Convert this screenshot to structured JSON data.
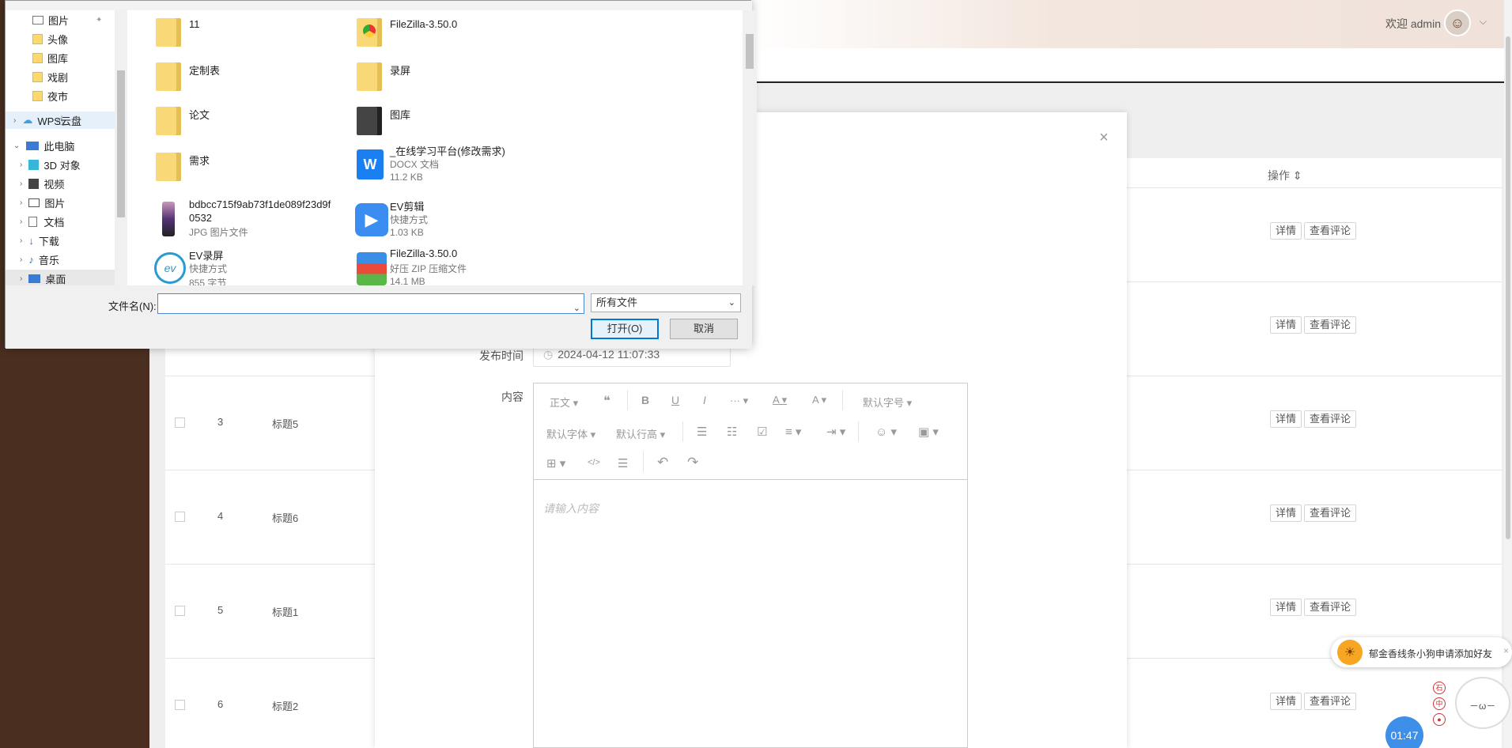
{
  "header": {
    "welcome": "欢迎 admin",
    "caret": "⌵"
  },
  "table": {
    "action_header": "操作 ⇕",
    "rows": [
      {
        "idx": "",
        "title": "",
        "detail": "详情",
        "comments": "查看评论"
      },
      {
        "idx": "",
        "title": "",
        "detail": "详情",
        "comments": "查看评论"
      },
      {
        "idx": "3",
        "title": "标题5",
        "detail": "详情",
        "comments": "查看评论"
      },
      {
        "idx": "4",
        "title": "标题6",
        "detail": "详情",
        "comments": "查看评论"
      },
      {
        "idx": "5",
        "title": "标题1",
        "detail": "详情",
        "comments": "查看评论"
      },
      {
        "idx": "6",
        "title": "标题2",
        "detail": "详情",
        "comments": "查看评论"
      }
    ]
  },
  "modal": {
    "close": "×",
    "publish_label": "发布时间",
    "publish_value": "2024-04-12 11:07:33",
    "content_label": "内容",
    "editor": {
      "toolbar": {
        "para": "正文 ▾",
        "quote": "❝",
        "bold": "B",
        "underline": "U",
        "italic": "I",
        "more": "··· ▾",
        "font_color": "A ▾",
        "bg_color": "A ▾",
        "font_size": "默认字号 ▾",
        "font_family": "默认字体 ▾",
        "line_height": "默认行高 ▾",
        "ul": "☰",
        "ol": "☷",
        "todo": "☑",
        "align": "≡ ▾",
        "indent": "⇥ ▾",
        "emoji": "☺ ▾",
        "image": "▣ ▾",
        "table": "⊞ ▾",
        "code": "</>",
        "divider": "☰",
        "undo": "↶",
        "redo": "↷"
      },
      "placeholder": "请输入内容"
    }
  },
  "file_dialog": {
    "tree": [
      {
        "label": "图片",
        "pin": "📌"
      },
      {
        "label": "头像"
      },
      {
        "label": "图库"
      },
      {
        "label": "戏剧"
      },
      {
        "label": "夜市"
      },
      {
        "label": "WPS云盘"
      },
      {
        "label": "此电脑"
      },
      {
        "label": "3D 对象"
      },
      {
        "label": "视频"
      },
      {
        "label": "图片"
      },
      {
        "label": "文档"
      },
      {
        "label": "下载"
      },
      {
        "label": "音乐"
      },
      {
        "label": "桌面"
      }
    ],
    "files": [
      {
        "name": "11",
        "type": "",
        "size": ""
      },
      {
        "name": "FileZilla-3.50.0",
        "type": "",
        "size": ""
      },
      {
        "name": "定制表",
        "type": "",
        "size": ""
      },
      {
        "name": "录屏",
        "type": "",
        "size": ""
      },
      {
        "name": "论文",
        "type": "",
        "size": ""
      },
      {
        "name": "图库",
        "type": "",
        "size": ""
      },
      {
        "name": "需求",
        "type": "",
        "size": ""
      },
      {
        "name": "_在线学习平台(修改需求)",
        "type": "DOCX 文档",
        "size": "11.2 KB"
      },
      {
        "name": "bdbcc715f9ab73f1de089f23d9f",
        "name2": "0532",
        "type": "JPG 图片文件",
        "size": ""
      },
      {
        "name": "EV剪辑",
        "type": "快捷方式",
        "size": "1.03 KB"
      },
      {
        "name": "EV录屏",
        "type": "快捷方式",
        "size": "855 字节"
      },
      {
        "name": "FileZilla-3.50.0",
        "type": "好压 ZIP 压缩文件",
        "size": "14.1 MB"
      }
    ],
    "filename_label": "文件名(N):",
    "filename_value": "",
    "filetype": "所有文件",
    "open": "打开(O)",
    "cancel": "取消"
  },
  "notification": {
    "text": "郁金香线条小狗申请添加好友",
    "close": "×"
  },
  "timer": "01:47",
  "side_icons": [
    "石",
    "中",
    "●"
  ]
}
